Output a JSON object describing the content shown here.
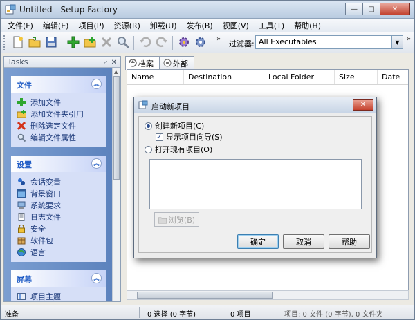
{
  "window": {
    "title": "Untitled - Setup Factory",
    "min_glyph": "—",
    "max_glyph": "□",
    "close_glyph": "✕"
  },
  "menu": [
    "文件(F)",
    "编辑(E)",
    "项目(P)",
    "资源(R)",
    "卸载(U)",
    "发布(B)",
    "视图(V)",
    "工具(T)",
    "帮助(H)"
  ],
  "toolbar": {
    "filter_label": "过滤器:",
    "filter_value": "All Executables",
    "overflow_glyph": "»"
  },
  "tasks": {
    "title": "Tasks",
    "groups": [
      {
        "title": "文件",
        "items": [
          "添加文件",
          "添加文件夹引用",
          "删除选定文件",
          "编辑文件属性"
        ]
      },
      {
        "title": "设置",
        "items": [
          "会话变量",
          "背景窗口",
          "系统要求",
          "日志文件",
          "安全",
          "软件包",
          "语言"
        ]
      },
      {
        "title": "屏幕",
        "items": [
          "项目主题"
        ]
      }
    ]
  },
  "tabs": [
    "档案",
    "外部"
  ],
  "columns": [
    "Name",
    "Destination",
    "Local Folder",
    "Size",
    "Date"
  ],
  "status": {
    "ready": "准备",
    "selection": "0 选择 (0 字节)",
    "items": "0 项目",
    "summary": "项目: 0 文件 (0 字节), 0 文件夹"
  },
  "dialog": {
    "title": "启动新项目",
    "radio_create": "创建新项目(C)",
    "check_wizard": "显示项目向导(S)",
    "radio_open": "打开现有项目(O)",
    "browse": "浏览(B)",
    "ok": "确定",
    "cancel": "取消",
    "help": "帮助"
  },
  "colors": {
    "task_pane_bg": "#6d90c8",
    "group_title": "#215dc6"
  }
}
